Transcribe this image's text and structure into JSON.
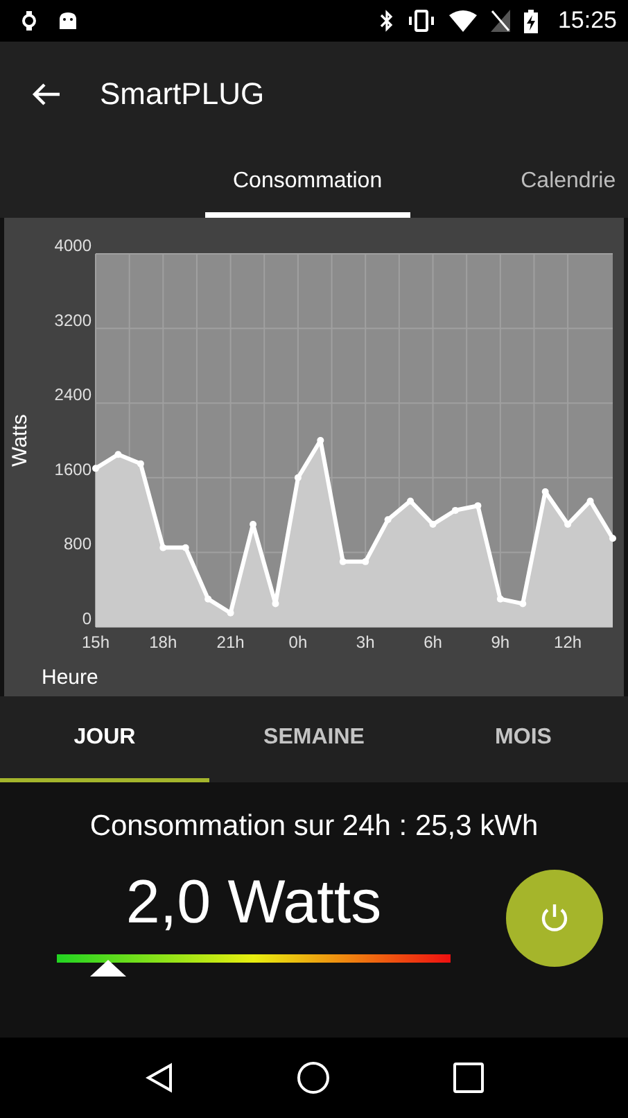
{
  "status_bar": {
    "time": "15:25"
  },
  "app_bar": {
    "title": "SmartPLUG"
  },
  "tabs": [
    {
      "label": "Consommation",
      "selected": true
    },
    {
      "label": "Calendrie",
      "selected": false
    }
  ],
  "chart": {
    "chart_data": {
      "type": "area",
      "xlabel": "Heure",
      "ylabel": "Watts",
      "categories": [
        "15h",
        null,
        null,
        "18h",
        null,
        null,
        "21h",
        null,
        null,
        "0h",
        null,
        null,
        "3h",
        null,
        null,
        "6h",
        null,
        null,
        "9h",
        null,
        null,
        "12h",
        null,
        null
      ],
      "series": [
        {
          "color": "#ffffff",
          "values": [
            1700,
            1850,
            1750,
            850,
            850,
            300,
            150,
            1100,
            250,
            1600,
            2000,
            700,
            700,
            1150,
            1350,
            1100,
            1250,
            1300,
            300,
            250,
            1450,
            1100,
            1350,
            950
          ]
        }
      ],
      "ylim": [
        0,
        4000
      ],
      "grid": true,
      "yticks": [
        0,
        800,
        1600,
        2400,
        3200,
        4000
      ]
    }
  },
  "periods": [
    {
      "label": "JOUR",
      "selected": true
    },
    {
      "label": "SEMAINE",
      "selected": false
    },
    {
      "label": "MOIS",
      "selected": false
    }
  ],
  "summary": "Consommation sur 24h : 25,3 kWh",
  "power": {
    "reading": "2,0 Watts",
    "level": 0.13,
    "on": true
  }
}
